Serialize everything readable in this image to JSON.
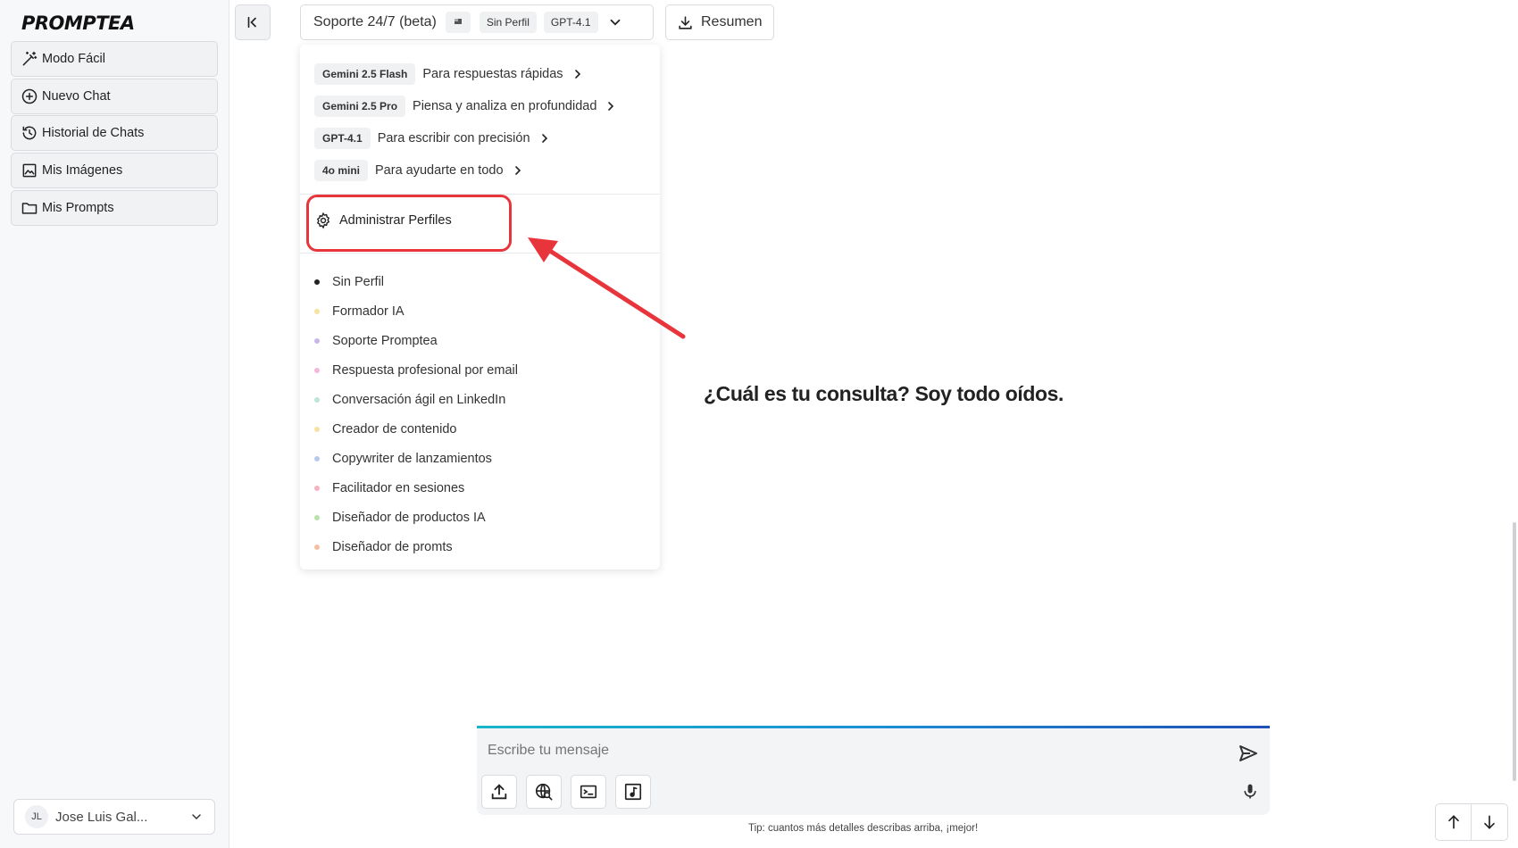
{
  "brand": {
    "logo_text": "PROMPTEA"
  },
  "sidebar": {
    "items": [
      {
        "label": "Modo Fácil",
        "icon": "magic-wand-icon"
      },
      {
        "label": "Nuevo Chat",
        "icon": "plus-circle-icon"
      },
      {
        "label": "Historial de Chats",
        "icon": "history-icon"
      },
      {
        "label": "Mis Imágenes",
        "icon": "image-icon"
      },
      {
        "label": "Mis Prompts",
        "icon": "folder-icon"
      }
    ],
    "user": {
      "initials": "JL",
      "name": "Jose Luis Gal..."
    }
  },
  "header": {
    "assistant_title": "Soporte 24/7 (beta)",
    "profile_chip": "Sin Perfil",
    "model_chip": "GPT-4.1",
    "resumen_label": "Resumen"
  },
  "dropdown": {
    "models": [
      {
        "name": "Gemini 2.5 Flash",
        "desc": "Para respuestas rápidas"
      },
      {
        "name": "Gemini 2.5 Pro",
        "desc": "Piensa y analiza en profundidad"
      },
      {
        "name": "GPT-4.1",
        "desc": "Para escribir con precisión"
      },
      {
        "name": "4o mini",
        "desc": "Para ayudarte en todo"
      }
    ],
    "admin_label": "Administrar Perfiles",
    "profiles": [
      {
        "label": "Sin Perfil",
        "color": "#222222"
      },
      {
        "label": "Formador IA",
        "color": "#f6e3a1"
      },
      {
        "label": "Soporte Promptea",
        "color": "#c9b7ea"
      },
      {
        "label": "Respuesta profesional por email",
        "color": "#f4b8dc"
      },
      {
        "label": "Conversación ágil en LinkedIn",
        "color": "#bfe6d4"
      },
      {
        "label": "Creador de contenido",
        "color": "#f6e3a1"
      },
      {
        "label": "Copywriter de lanzamientos",
        "color": "#b9c9ee"
      },
      {
        "label": "Facilitador en sesiones",
        "color": "#f4b3bf"
      },
      {
        "label": "Diseñador de productos IA",
        "color": "#b7e3a9"
      },
      {
        "label": "Diseñador de promts",
        "color": "#f6bfa3"
      }
    ]
  },
  "main": {
    "greeting": "¿Cuál es tu consulta? Soy todo oídos."
  },
  "composer": {
    "placeholder": "Escribe tu mensaje",
    "tip": "Tip: cuantos más detalles describas arriba, ¡mejor!"
  },
  "colors": {
    "highlight": "#e8353c",
    "accent_start": "#17b6c9",
    "accent_end": "#1f4fb8"
  }
}
